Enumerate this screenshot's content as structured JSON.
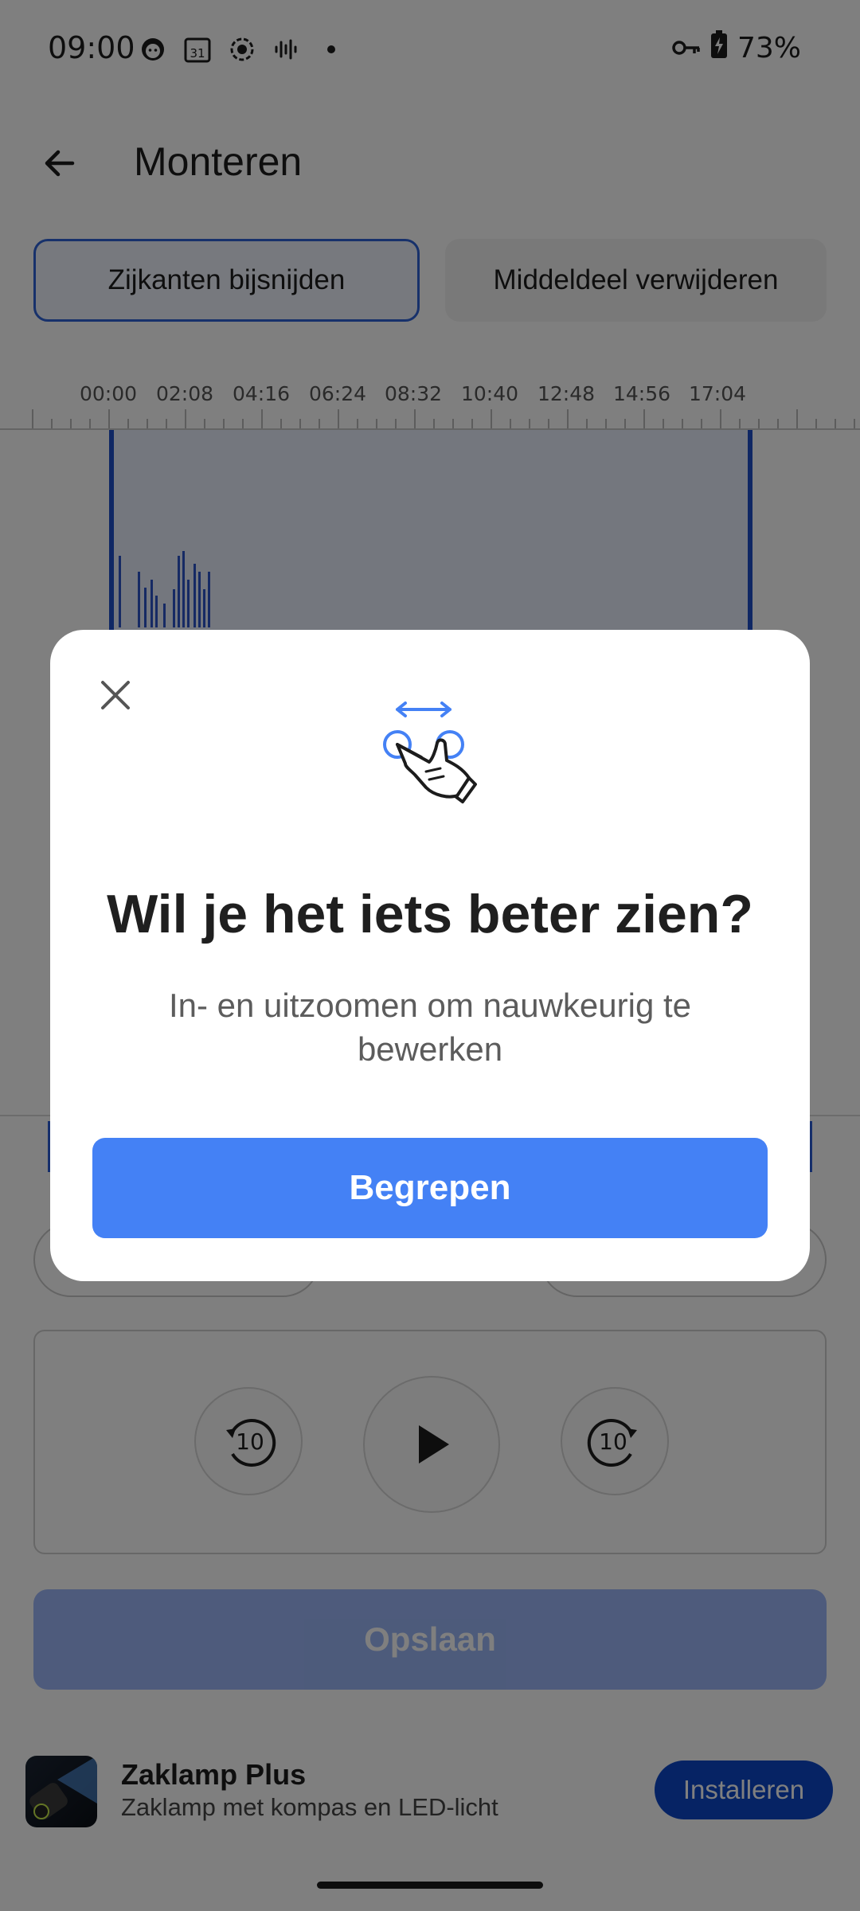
{
  "status_bar": {
    "time": "09:00",
    "battery": "73%",
    "calendar_day": "31"
  },
  "app_bar": {
    "title": "Monteren"
  },
  "mode_tabs": [
    {
      "label": "Zijkanten bijsnijden",
      "active": true
    },
    {
      "label": "Middeldeel verwijderen",
      "active": false
    }
  ],
  "timeline": {
    "ticks": [
      "00:00",
      "02:08",
      "04:16",
      "06:24",
      "08:32",
      "10:40",
      "12:48",
      "14:56",
      "17:04"
    ]
  },
  "player": {
    "rewind_label": "10",
    "forward_label": "10"
  },
  "save_button": {
    "label": "Opslaan"
  },
  "ad": {
    "title": "Zaklamp Plus",
    "subtitle": "Zaklamp met kompas en LED-licht",
    "install_label": "Installeren"
  },
  "dialog": {
    "title": "Wil je het iets beter zien?",
    "body": "In- en uitzoomen om nauwkeurig te bewerken",
    "button_label": "Begrepen"
  },
  "colors": {
    "accent": "#4481f5",
    "selection_border": "#1f4fc8",
    "install_button": "#0d47c9"
  }
}
